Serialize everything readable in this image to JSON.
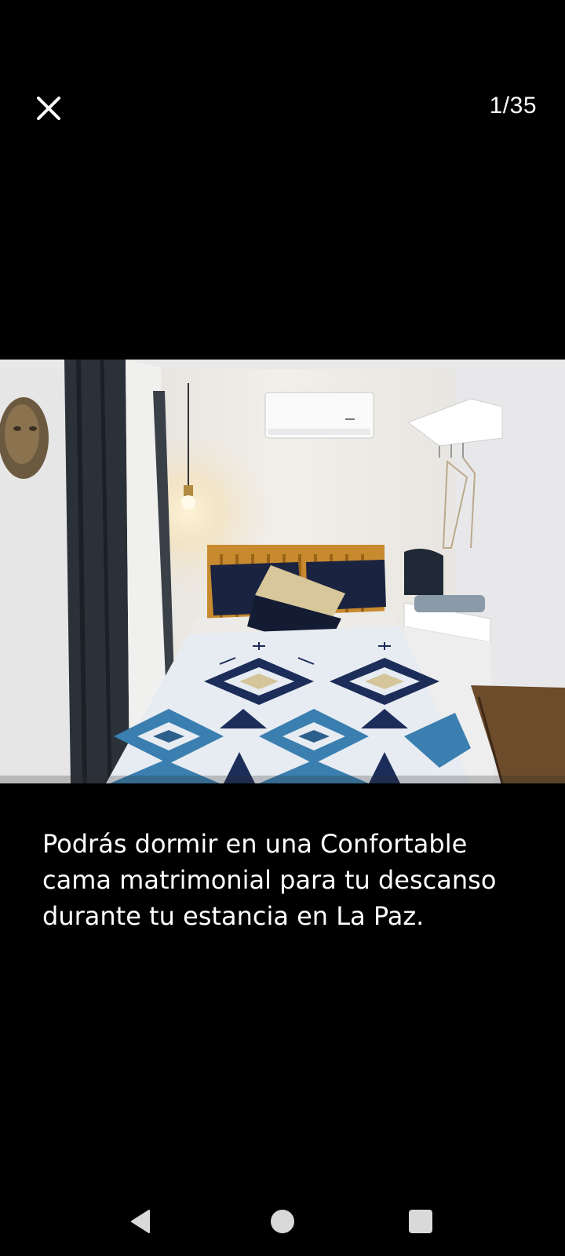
{
  "header": {
    "photo_counter": "1/35",
    "close_icon": "close-icon"
  },
  "photo": {
    "subject": "bedroom-photo"
  },
  "caption": {
    "text": "Podrás dormir en una Confortable cama matrimonial para tu descanso durante tu estancia en La Paz."
  },
  "system_nav": {
    "back_icon": "back-triangle-icon",
    "home_icon": "home-circle-icon",
    "recents_icon": "recents-square-icon"
  }
}
